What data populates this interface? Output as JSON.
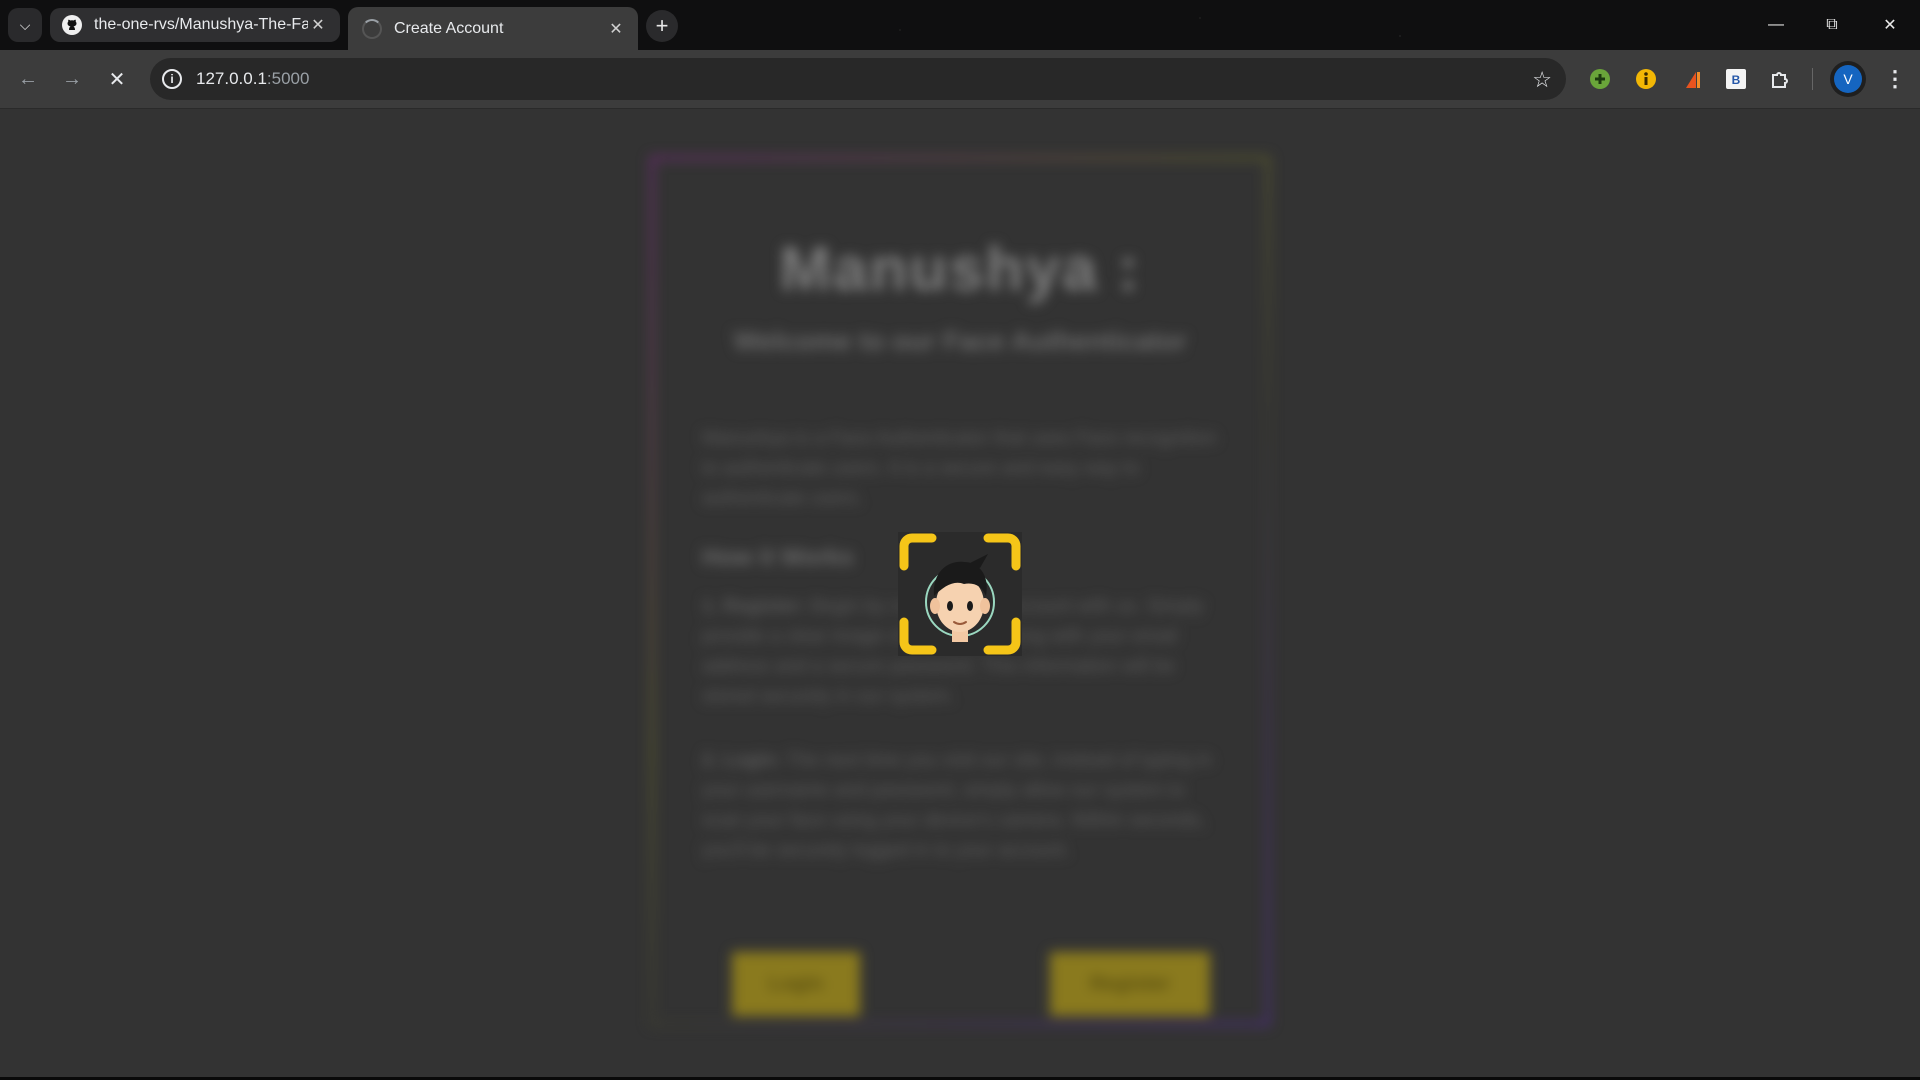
{
  "browser": {
    "tabs": [
      {
        "label": "the-one-rvs/Manushya-The-Fac",
        "icon": "github-icon"
      },
      {
        "label": "Create Account",
        "icon": "loading-spinner-icon"
      }
    ],
    "new_tab": "+",
    "address": {
      "host": "127.0.0.1",
      "port": ":5000"
    },
    "profile_initial": "V",
    "extensions": [
      "green-plus-extension-icon",
      "yellow-info-extension-icon",
      "orange-extension-icon",
      "b-extension-icon",
      "puzzle-extensions-icon"
    ]
  },
  "page": {
    "title": "Manushya :",
    "subtitle": "Welcome to our Face Authenticator",
    "intro": "Manushya is a Face Authenticator that uses Face recognition to authenticate users. It is a secure and easy way to authenticate users.",
    "how_heading": "How it Works",
    "step1_title": "1. Register:",
    "step1_text": "Begin by creating your account with us. Simply provide a clear image of your face, along with your email address and a secure password. This information will be stored securely in our system.",
    "step2_title": "2. Login:",
    "step2_text": "The next time you visit our site, instead of typing in your username and password, simply allow our system to scan your face using your device's camera. Within seconds, you'll be securely logged in to your account.",
    "login_label": "Login",
    "register_label": "Register"
  },
  "colors": {
    "accent_yellow": "#f5c518",
    "page_bg": "#333333",
    "profile_blue": "#1565c0"
  }
}
